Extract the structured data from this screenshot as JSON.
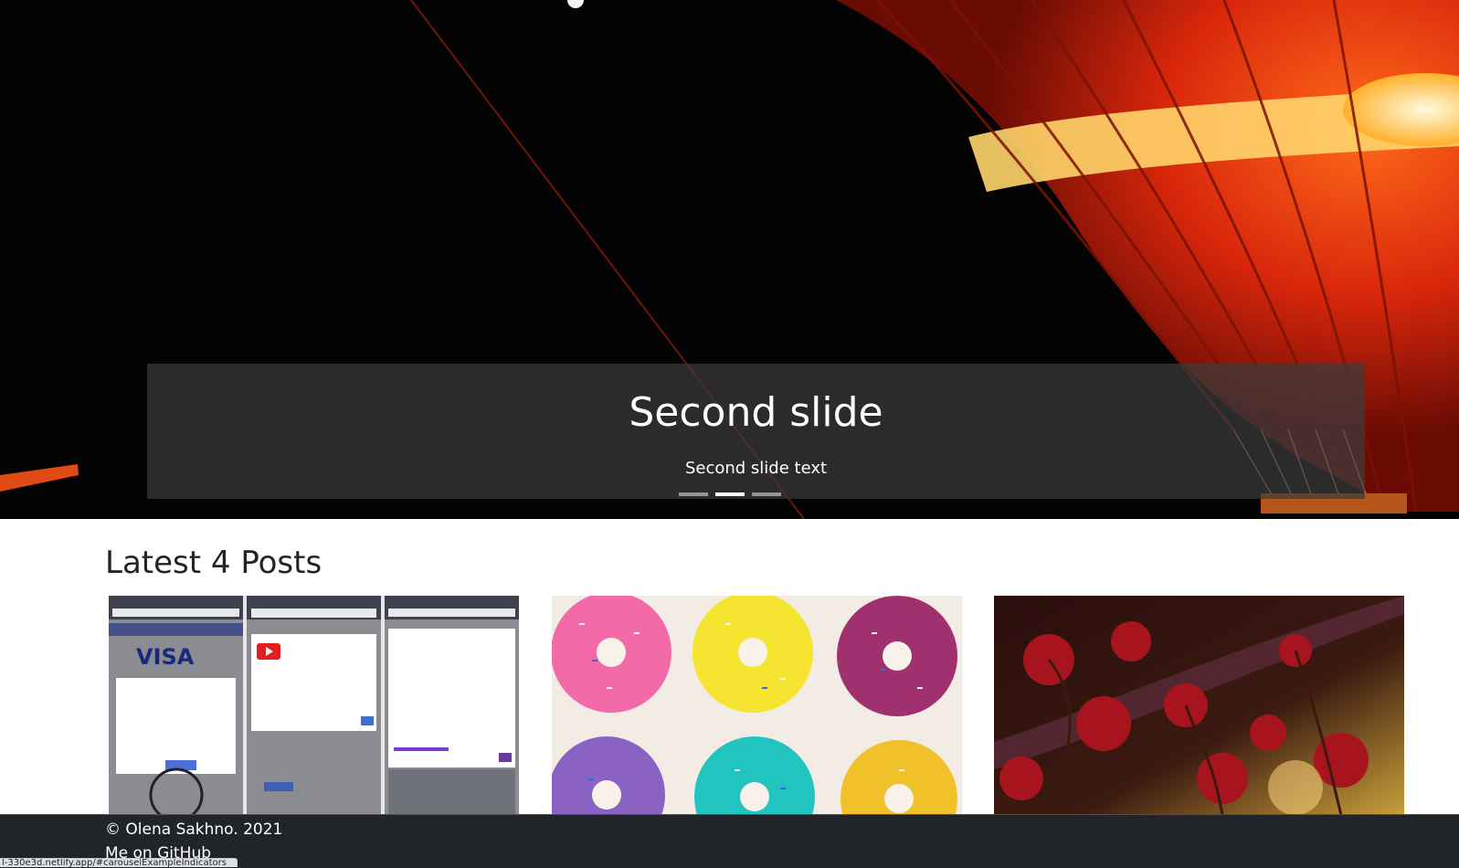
{
  "carousel": {
    "active_index": 1,
    "slide": {
      "title": "Second slide",
      "text": "Second slide text",
      "image": "hot-air-balloon-night"
    },
    "indicators": [
      "slide-1",
      "slide-2",
      "slide-3"
    ]
  },
  "posts": {
    "heading": "Latest 4 Posts",
    "items": [
      {
        "image": "scam-popup-screenshots"
      },
      {
        "image": "frosted-donuts"
      },
      {
        "image": "red-flowers-sunset"
      }
    ]
  },
  "footer": {
    "copyright": "© Olena Sakhno. 2021",
    "github_link": "Me on GitHub"
  },
  "status_bar": {
    "url": "l-330e3d.netlify.app/#carouselExampleIndicators"
  },
  "colors": {
    "footer_bg": "#212529",
    "balloon_red": "#e8300e",
    "caption_bg": "#3c3c3c"
  }
}
